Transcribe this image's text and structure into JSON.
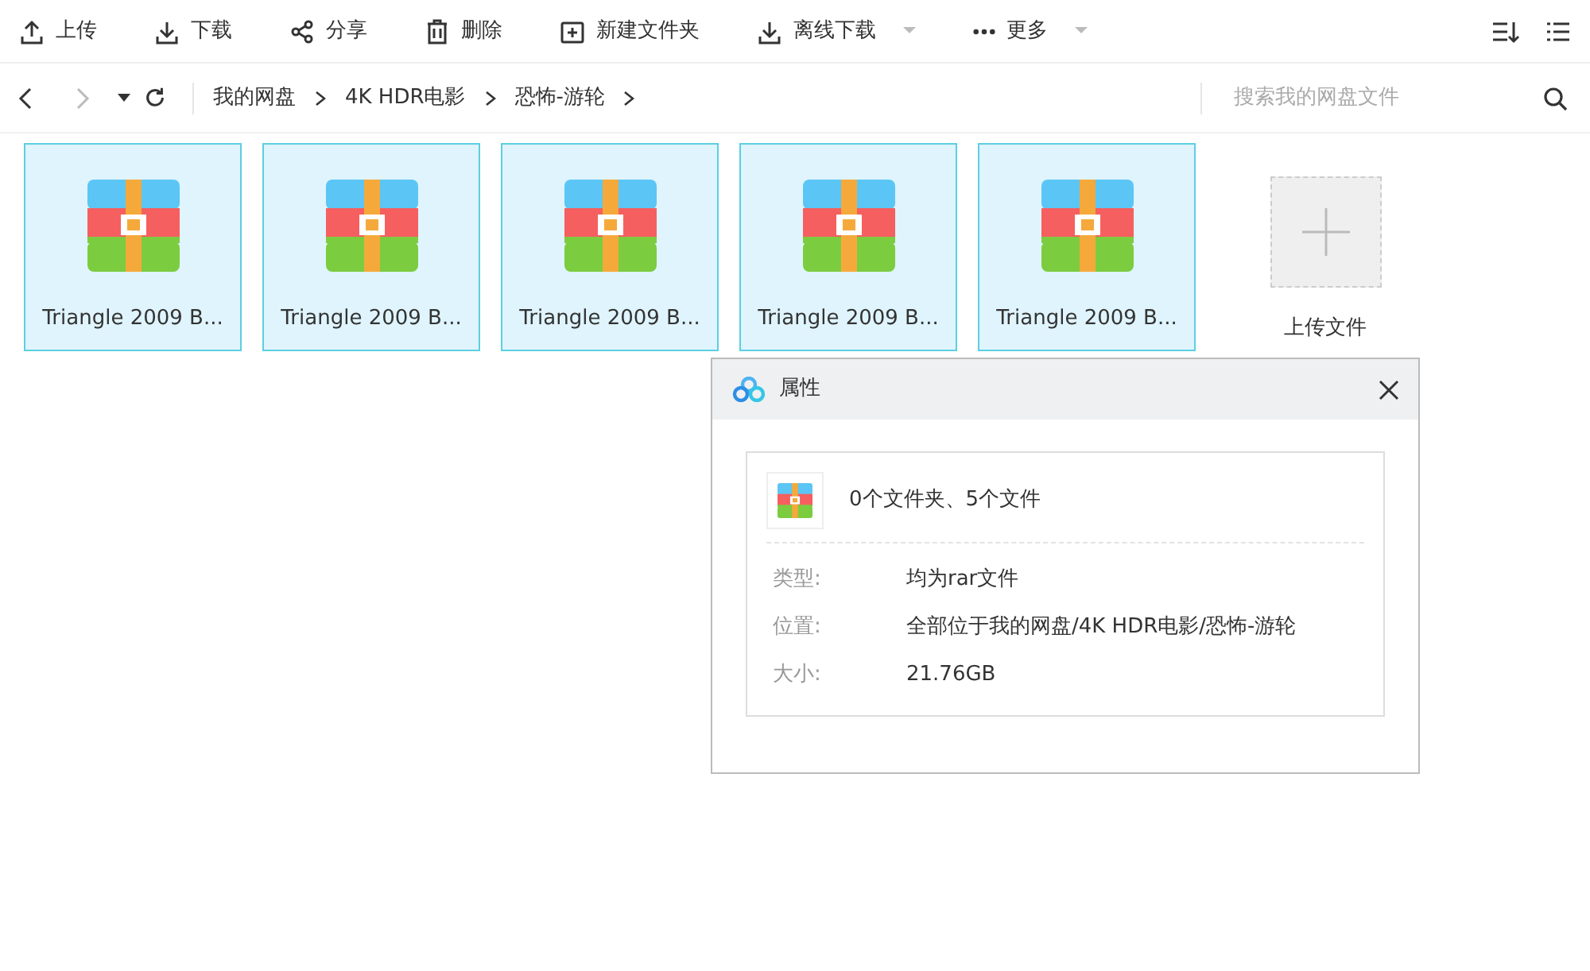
{
  "toolbar": [
    {
      "label": "上传",
      "kind": "upload",
      "dropdown": false
    },
    {
      "label": "下载",
      "kind": "download",
      "dropdown": false
    },
    {
      "label": "分享",
      "kind": "share",
      "dropdown": false
    },
    {
      "label": "删除",
      "kind": "delete",
      "dropdown": false
    },
    {
      "label": "新建文件夹",
      "kind": "newfolder",
      "dropdown": false
    },
    {
      "label": "离线下载",
      "kind": "download",
      "dropdown": true
    },
    {
      "label": "更多",
      "kind": "more",
      "dropdown": true
    }
  ],
  "breadcrumb": [
    "我的网盘",
    "4K HDR电影",
    "恐怖-游轮"
  ],
  "search": {
    "placeholder": "搜索我的网盘文件"
  },
  "files": [
    {
      "name": "Triangle 2009 B...",
      "selected": true
    },
    {
      "name": "Triangle 2009 B...",
      "selected": true
    },
    {
      "name": "Triangle 2009 B...",
      "selected": true
    },
    {
      "name": "Triangle 2009 B...",
      "selected": true
    },
    {
      "name": "Triangle 2009 B...",
      "selected": true
    }
  ],
  "upload_tile": {
    "label": "上传文件"
  },
  "dialog": {
    "title": "属性",
    "summary": "0个文件夹、5个文件",
    "properties": [
      {
        "label": "类型:",
        "value": "均为rar文件"
      },
      {
        "label": "位置:",
        "value": "全部位于我的网盘/4K HDR电影/恐怖-游轮"
      },
      {
        "label": "大小:",
        "value": "21.76GB"
      }
    ]
  }
}
